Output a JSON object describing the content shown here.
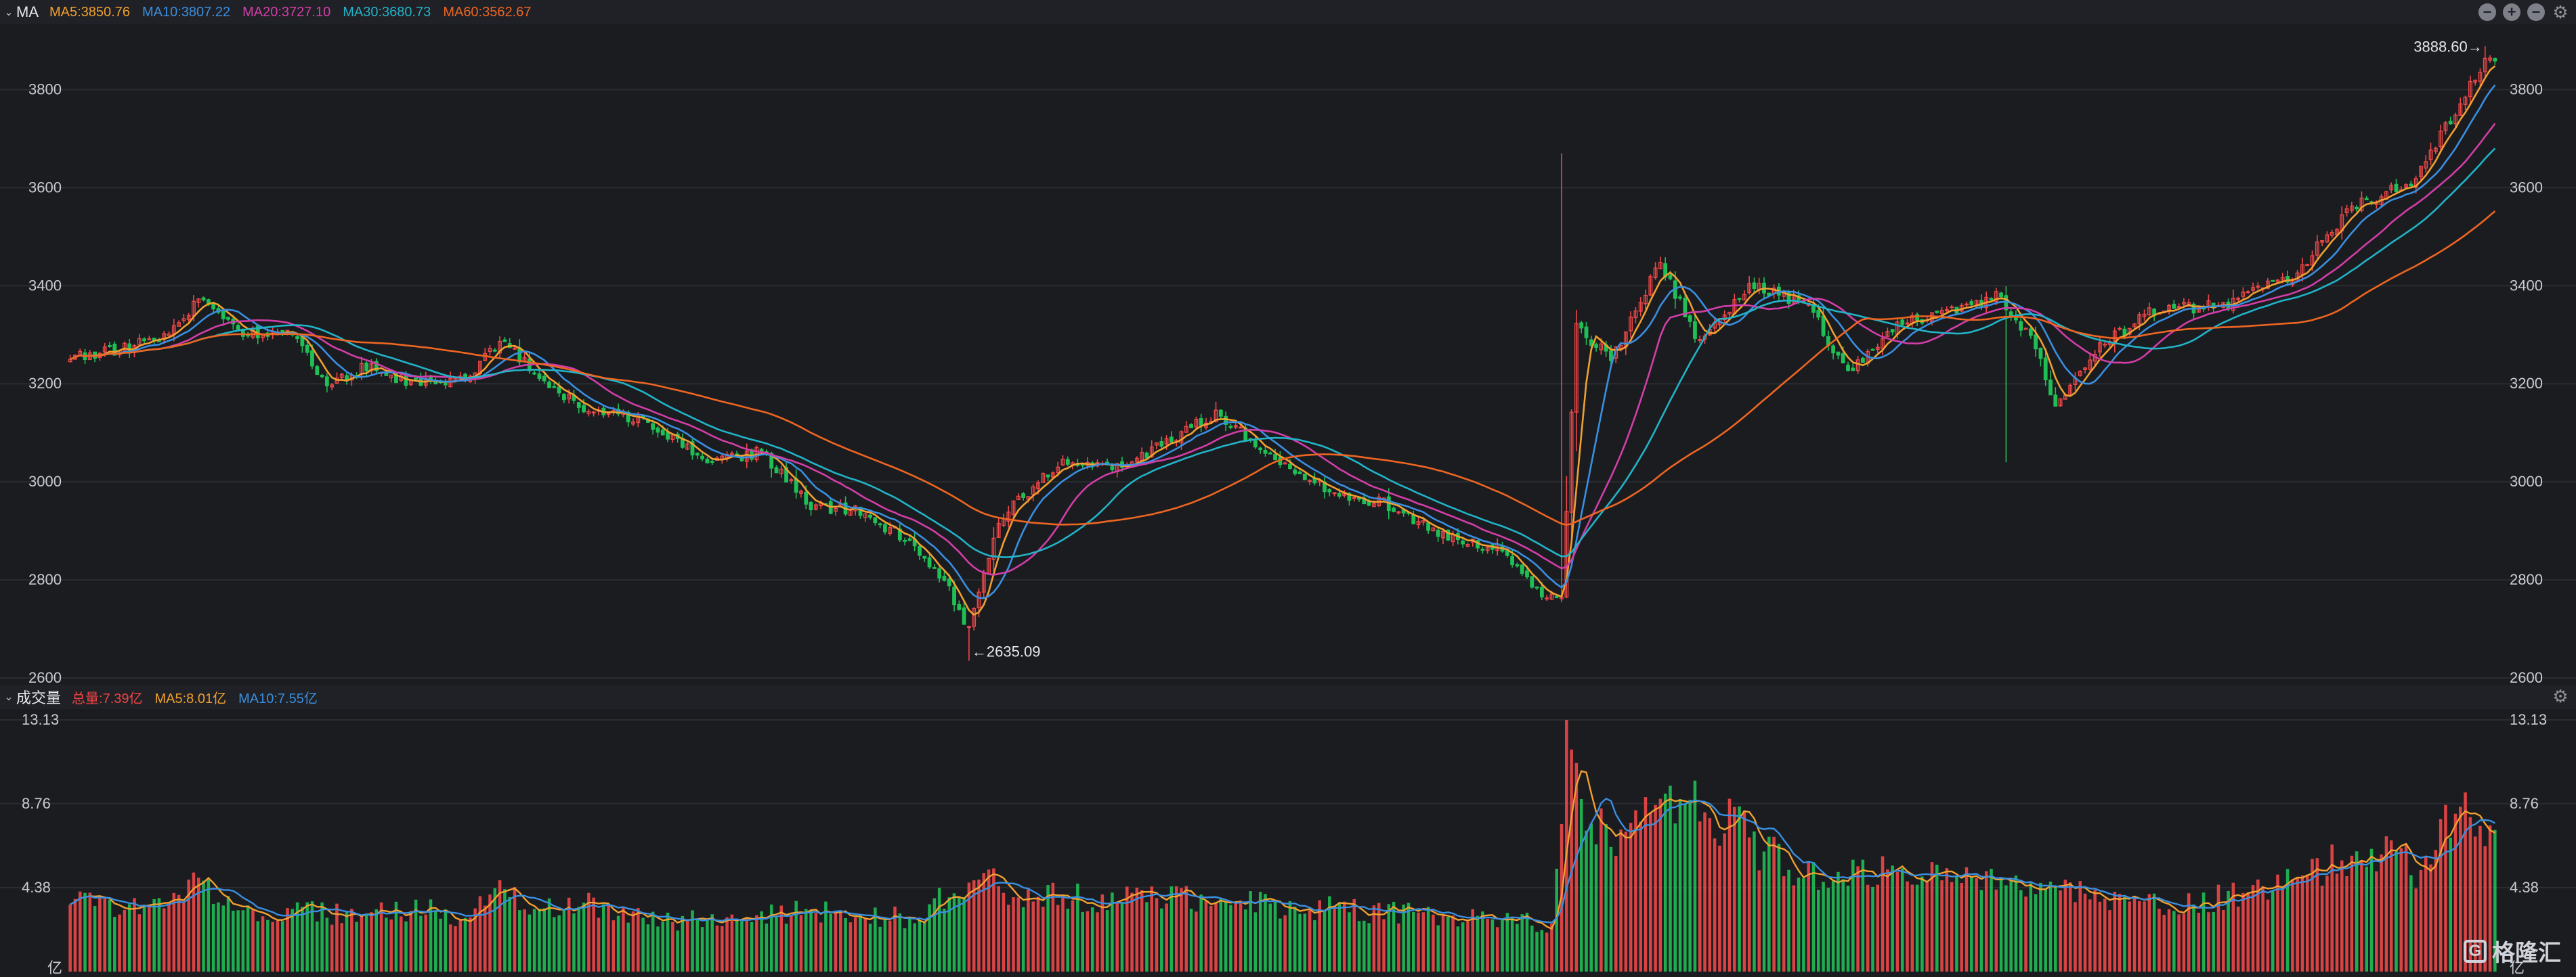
{
  "ma_legend": {
    "title": "MA",
    "items": [
      {
        "label": "MA5:3850.76",
        "color": "#f0a030"
      },
      {
        "label": "MA10:3807.22",
        "color": "#3a8fe0"
      },
      {
        "label": "MA20:3727.10",
        "color": "#d23ea8"
      },
      {
        "label": "MA30:3680.73",
        "color": "#22b3c8"
      },
      {
        "label": "MA60:3562.67",
        "color": "#ee6622"
      }
    ]
  },
  "volume_legend": {
    "title": "成交量",
    "items": [
      {
        "label": "总量:7.39亿",
        "color": "#ee4444"
      },
      {
        "label": "MA5:8.01亿",
        "color": "#f0a030"
      },
      {
        "label": "MA10:7.55亿",
        "color": "#3a8fe0"
      }
    ]
  },
  "icons": {
    "minus": "minus-circle-icon",
    "plus": "plus-circle-icon",
    "settings": "gear-icon"
  },
  "watermark": "格隆汇",
  "colors": {
    "up": "#f04848",
    "down": "#1fbf55",
    "grid": "#2a2c31",
    "axis_text": "#c9ccd2",
    "background": "#1b1c20"
  },
  "chart_data": [
    {
      "type": "candlestick",
      "title": "",
      "ylim": [
        2600,
        3900
      ],
      "y_ticks": [
        "2600",
        "2800",
        "3000",
        "3200",
        "3400",
        "3600",
        "3800"
      ],
      "annotations": [
        {
          "label": "←2635.09",
          "bar_index": 182,
          "value": 2635.09
        },
        {
          "label": "3888.60→",
          "bar_index": 489,
          "value": 3888.6
        }
      ],
      "bar_count": 492,
      "close_anchors": [
        [
          0,
          3250
        ],
        [
          18,
          3290
        ],
        [
          26,
          3370
        ],
        [
          36,
          3300
        ],
        [
          44,
          3310
        ],
        [
          52,
          3200
        ],
        [
          60,
          3235
        ],
        [
          70,
          3200
        ],
        [
          80,
          3215
        ],
        [
          88,
          3290
        ],
        [
          96,
          3200
        ],
        [
          104,
          3150
        ],
        [
          114,
          3130
        ],
        [
          124,
          3080
        ],
        [
          130,
          3040
        ],
        [
          140,
          3060
        ],
        [
          150,
          2950
        ],
        [
          160,
          2940
        ],
        [
          170,
          2880
        ],
        [
          178,
          2780
        ],
        [
          182,
          2700
        ],
        [
          188,
          2920
        ],
        [
          200,
          3040
        ],
        [
          212,
          3030
        ],
        [
          222,
          3080
        ],
        [
          232,
          3140
        ],
        [
          244,
          3050
        ],
        [
          256,
          2980
        ],
        [
          268,
          2950
        ],
        [
          278,
          2890
        ],
        [
          290,
          2860
        ],
        [
          298,
          2760
        ],
        [
          302,
          2760
        ],
        [
          305,
          3320
        ],
        [
          312,
          3250
        ],
        [
          322,
          3450
        ],
        [
          330,
          3280
        ],
        [
          340,
          3400
        ],
        [
          352,
          3360
        ],
        [
          360,
          3220
        ],
        [
          370,
          3320
        ],
        [
          382,
          3350
        ],
        [
          390,
          3380
        ],
        [
          398,
          3280
        ],
        [
          402,
          3150
        ],
        [
          410,
          3270
        ],
        [
          422,
          3350
        ],
        [
          436,
          3360
        ],
        [
          450,
          3420
        ],
        [
          462,
          3560
        ],
        [
          474,
          3610
        ],
        [
          484,
          3770
        ],
        [
          489,
          3860
        ],
        [
          491,
          3850
        ]
      ],
      "spike_bars": [
        {
          "bar_index": 302,
          "high": 3670,
          "low": 2800
        },
        {
          "bar_index": 392,
          "high": 3210,
          "low": 3040
        }
      ],
      "moving_averages": [
        {
          "name": "MA5",
          "window": 5,
          "color": "#f0a030"
        },
        {
          "name": "MA10",
          "window": 10,
          "color": "#3a8fe0"
        },
        {
          "name": "MA20",
          "window": 20,
          "color": "#d23ea8"
        },
        {
          "name": "MA30",
          "window": 30,
          "color": "#22b3c8"
        },
        {
          "name": "MA60",
          "window": 60,
          "color": "#ee6622"
        }
      ]
    },
    {
      "type": "bar",
      "title": "",
      "unit": "亿",
      "ylim": [
        0,
        13.13
      ],
      "y_ticks": [
        "4.38",
        "8.76",
        "13.13"
      ],
      "volume_anchors": [
        [
          0,
          3.5
        ],
        [
          20,
          3.6
        ],
        [
          26,
          4.9
        ],
        [
          34,
          3.2
        ],
        [
          60,
          3.0
        ],
        [
          74,
          3.2
        ],
        [
          80,
          2.8
        ],
        [
          88,
          4.3
        ],
        [
          96,
          3.3
        ],
        [
          104,
          3.6
        ],
        [
          120,
          2.6
        ],
        [
          150,
          3.2
        ],
        [
          170,
          2.8
        ],
        [
          184,
          4.8
        ],
        [
          196,
          3.9
        ],
        [
          230,
          3.7
        ],
        [
          290,
          2.7
        ],
        [
          300,
          2.5
        ],
        [
          303,
          13.13
        ],
        [
          306,
          9.0
        ],
        [
          312,
          6.5
        ],
        [
          320,
          8.3
        ],
        [
          326,
          9.0
        ],
        [
          340,
          7.0
        ],
        [
          350,
          4.9
        ],
        [
          370,
          5.2
        ],
        [
          392,
          4.5
        ],
        [
          400,
          4.3
        ],
        [
          430,
          3.5
        ],
        [
          450,
          4.8
        ],
        [
          466,
          6.4
        ],
        [
          476,
          5.3
        ],
        [
          484,
          8.6
        ],
        [
          491,
          7.39
        ]
      ],
      "moving_averages": [
        {
          "name": "MA5",
          "window": 5,
          "color": "#f0a030"
        },
        {
          "name": "MA10",
          "window": 10,
          "color": "#3a8fe0"
        }
      ]
    }
  ]
}
